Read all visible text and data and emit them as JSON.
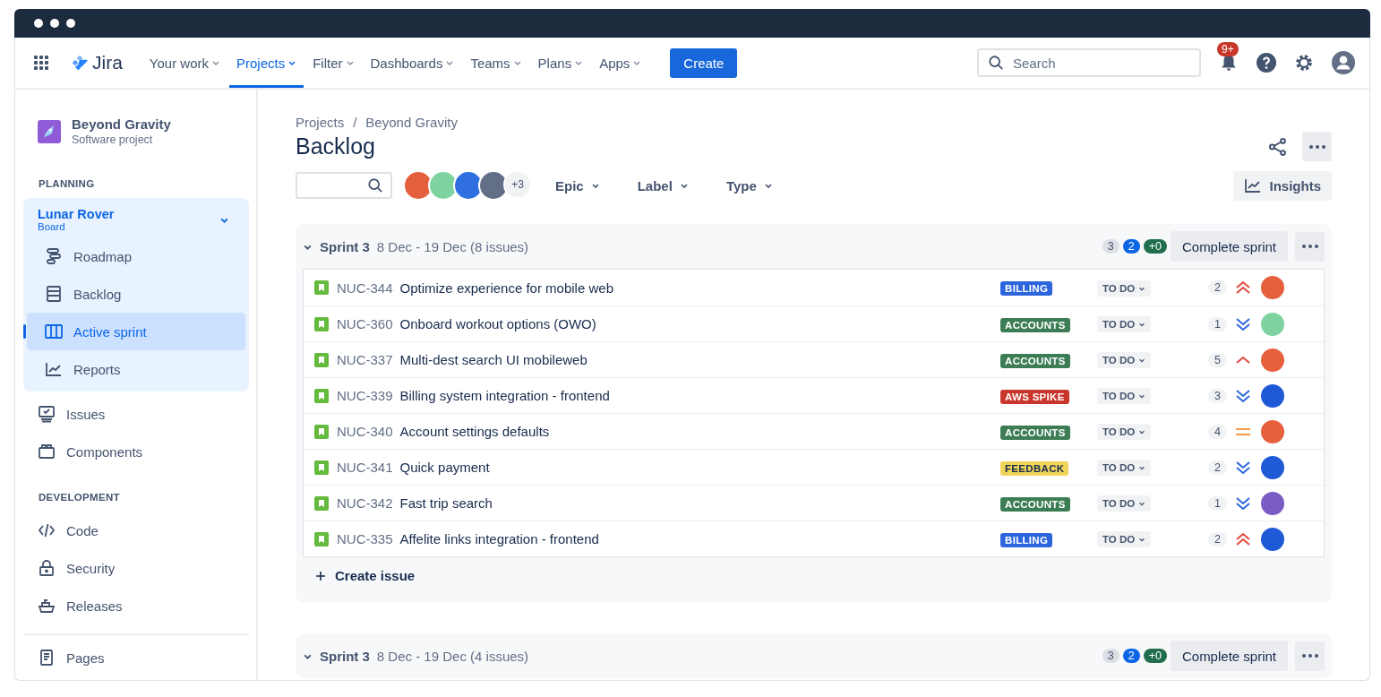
{
  "nav": {
    "product": "Jira",
    "items": [
      {
        "label": "Your work",
        "selected": false
      },
      {
        "label": "Projects",
        "selected": true
      },
      {
        "label": "Filter",
        "selected": false
      },
      {
        "label": "Dashboards",
        "selected": false
      },
      {
        "label": "Teams",
        "selected": false
      },
      {
        "label": "Plans",
        "selected": false
      },
      {
        "label": "Apps",
        "selected": false
      }
    ],
    "create": "Create",
    "search": {
      "placeholder": "Search"
    },
    "notifications": "9+"
  },
  "sidebar": {
    "project": {
      "name": "Beyond Gravity",
      "type": "Software project"
    },
    "sections": [
      {
        "title": "PLANNING",
        "items": [
          {
            "kind": "board",
            "label": "Lunar Rover",
            "sublabel": "Board",
            "expanded": true,
            "children": [
              {
                "kind": "roadmap",
                "label": "Roadmap",
                "selected": false
              },
              {
                "kind": "backlog",
                "label": "Backlog",
                "selected": false
              },
              {
                "kind": "sprint",
                "label": "Active sprint",
                "selected": true
              },
              {
                "kind": "reports",
                "label": "Reports",
                "selected": false
              }
            ]
          },
          {
            "kind": "issues",
            "label": "Issues",
            "selected": false
          },
          {
            "kind": "components",
            "label": "Components",
            "selected": false
          }
        ]
      },
      {
        "title": "DEVELOPMENT",
        "items": [
          {
            "kind": "code",
            "label": "Code",
            "selected": false
          },
          {
            "kind": "security",
            "label": "Security",
            "selected": false
          },
          {
            "kind": "releases",
            "label": "Releases",
            "selected": false
          }
        ]
      },
      {
        "items": [
          {
            "kind": "pages",
            "label": "Pages",
            "selected": false
          }
        ]
      }
    ]
  },
  "breadcrumbs": {
    "items": [
      "Projects",
      "Beyond Gravity"
    ],
    "separator": "/"
  },
  "title": "Backlog",
  "filters": {
    "avatars": [
      {
        "color": "#e5603c"
      },
      {
        "color": "#7fd3a0"
      },
      {
        "color": "#2f6fe0"
      },
      {
        "color": "#626f86"
      }
    ],
    "more": "+3",
    "dropdowns": [
      "Epic",
      "Label",
      "Type"
    ],
    "insights": "Insights"
  },
  "sprints": [
    {
      "name": "Sprint 3",
      "dates": "8 Dec - 19 Dec (8 issues)",
      "expanded": true,
      "counts": [
        "3",
        "2",
        "+0"
      ],
      "complete": "Complete sprint",
      "create_issue": "Create issue",
      "issues": [
        {
          "key": "NUC-344",
          "summary": "Optimize experience for mobile web",
          "label": {
            "text": "BILLING",
            "color": "#2d66dc"
          },
          "status": "TO DO",
          "points": "2",
          "priority": {
            "kind": "highest"
          },
          "assignee": {
            "color": "#e5603c"
          }
        },
        {
          "key": "NUC-360",
          "summary": "Onboard workout options (OWO)",
          "label": {
            "text": "ACCOUNTS",
            "color": "#3d7d55"
          },
          "status": "TO DO",
          "points": "1",
          "priority": {
            "kind": "lowest"
          },
          "assignee": {
            "color": "#7fd3a0"
          }
        },
        {
          "key": "NUC-337",
          "summary": "Multi-dest search UI mobileweb",
          "label": {
            "text": "ACCOUNTS",
            "color": "#3d7d55"
          },
          "status": "TO DO",
          "points": "5",
          "priority": {
            "kind": "high"
          },
          "assignee": {
            "color": "#e5603c"
          }
        },
        {
          "key": "NUC-339",
          "summary": "Billing system integration - frontend",
          "label": {
            "text": "AWS SPIKE",
            "color": "#c9372c"
          },
          "status": "TO DO",
          "points": "3",
          "priority": {
            "kind": "lowest"
          },
          "assignee": {
            "color": "#1f5ad6"
          }
        },
        {
          "key": "NUC-340",
          "summary": "Account settings defaults",
          "label": {
            "text": "ACCOUNTS",
            "color": "#3d7d55"
          },
          "status": "TO DO",
          "points": "4",
          "priority": {
            "kind": "medium"
          },
          "assignee": {
            "color": "#e5603c"
          }
        },
        {
          "key": "NUC-341",
          "summary": "Quick payment",
          "label": {
            "text": "FEEDBACK",
            "color": "#f1d45a"
          },
          "status": "TO DO",
          "points": "2",
          "priority": {
            "kind": "lowest"
          },
          "assignee": {
            "color": "#1f5ad6"
          }
        },
        {
          "key": "NUC-342",
          "summary": "Fast trip search",
          "label": {
            "text": "ACCOUNTS",
            "color": "#3d7d55"
          },
          "status": "TO DO",
          "points": "1",
          "priority": {
            "kind": "lowest"
          },
          "assignee": {
            "color": "#7b5cc4"
          }
        },
        {
          "key": "NUC-335",
          "summary": "Affelite links integration - frontend",
          "label": {
            "text": "BILLING",
            "color": "#2d66dc"
          },
          "status": "TO DO",
          "points": "2",
          "priority": {
            "kind": "highest"
          },
          "assignee": {
            "color": "#1f5ad6"
          }
        }
      ]
    },
    {
      "name": "Sprint 3",
      "dates": "8 Dec - 19 Dec (4 issues)",
      "expanded": true,
      "counts": [
        "3",
        "2",
        "+0"
      ],
      "complete": "Complete sprint"
    }
  ]
}
